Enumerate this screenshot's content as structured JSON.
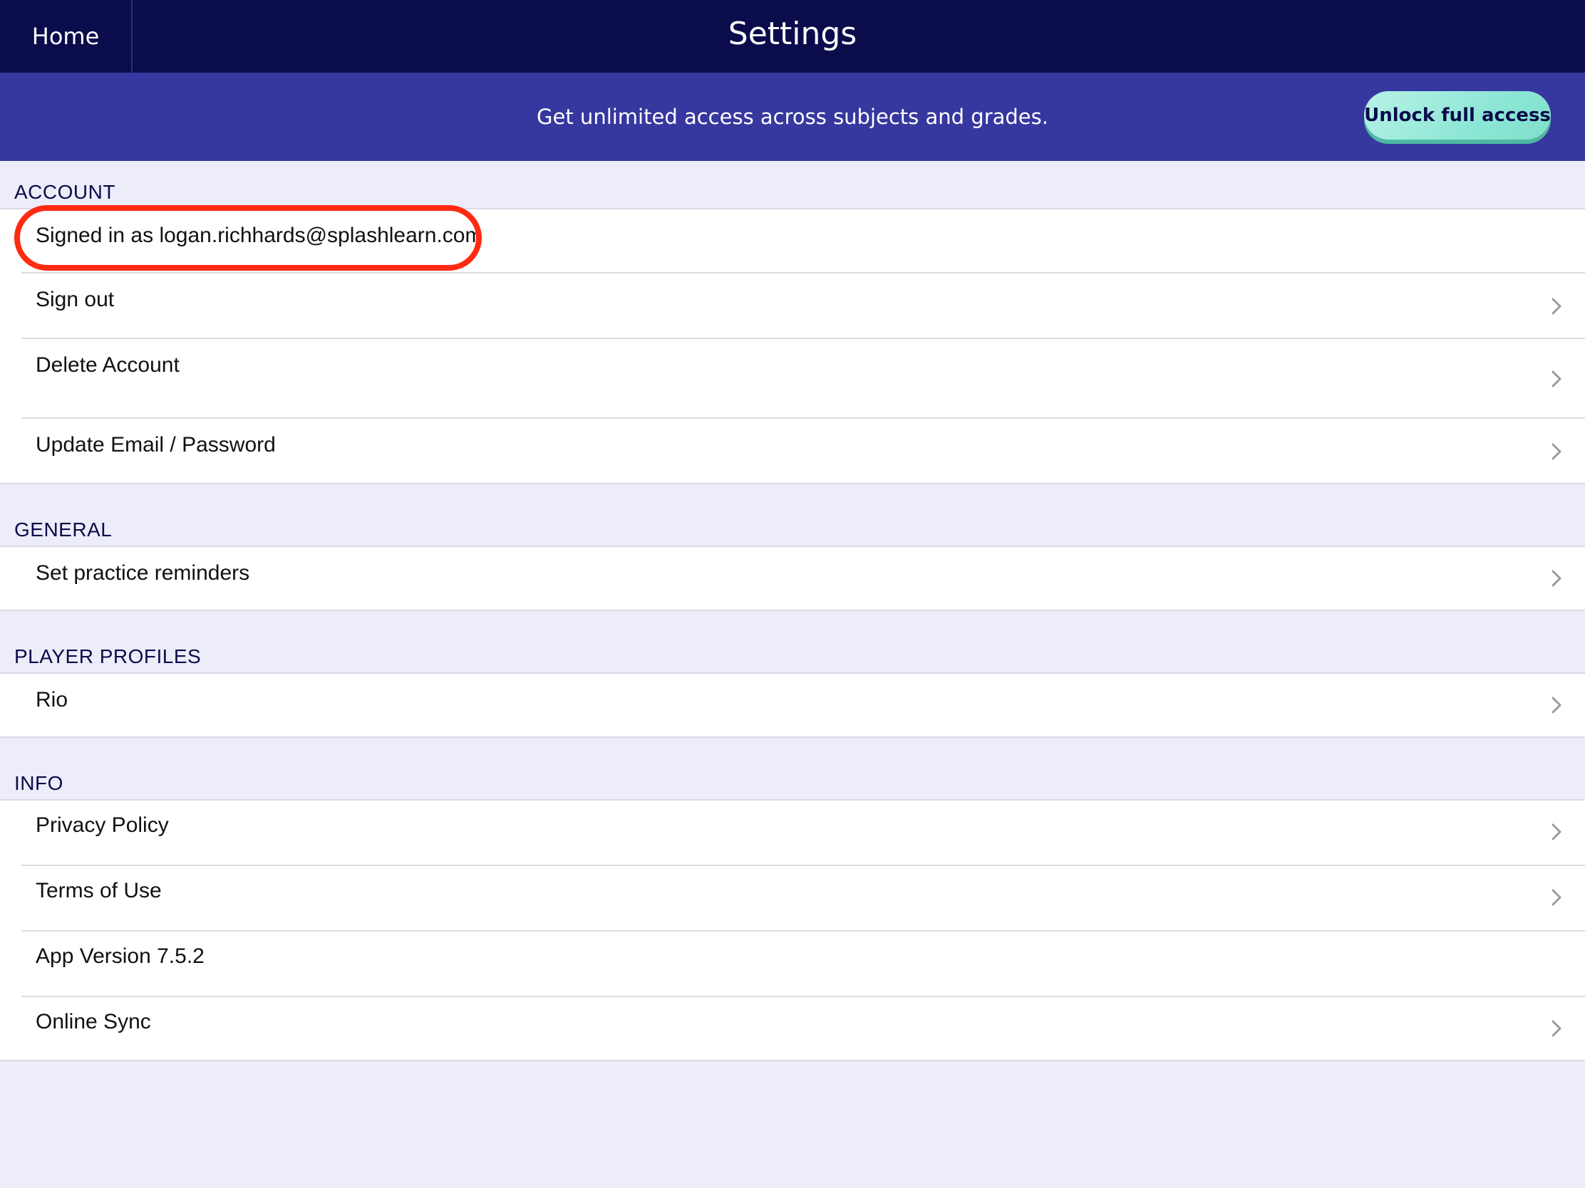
{
  "nav": {
    "home_label": "Home",
    "title": "Settings"
  },
  "banner": {
    "text": "Get unlimited access across subjects and grades.",
    "button_label": "Unlock full access"
  },
  "sections": {
    "account": {
      "header": "ACCOUNT",
      "signed_in": "Signed in as logan.richhards@splashlearn.com",
      "sign_out": "Sign out",
      "delete_account": "Delete Account",
      "update_email": "Update Email / Password"
    },
    "general": {
      "header": "GENERAL",
      "practice_reminders": "Set practice reminders"
    },
    "player_profiles": {
      "header": "PLAYER PROFILES",
      "rio": "Rio"
    },
    "info": {
      "header": "INFO",
      "privacy_policy": "Privacy Policy",
      "terms_of_use": "Terms of Use",
      "app_version": "App Version 7.5.2",
      "online_sync": "Online Sync"
    }
  },
  "colors": {
    "navbar": "#0b0c4b",
    "banner": "#3737a0",
    "page_background": "#ecedf8",
    "highlight": "#ff2a12",
    "unlock_button": "#8ee7d6"
  },
  "icons": {
    "row_chevron": "chevron-right-icon"
  }
}
